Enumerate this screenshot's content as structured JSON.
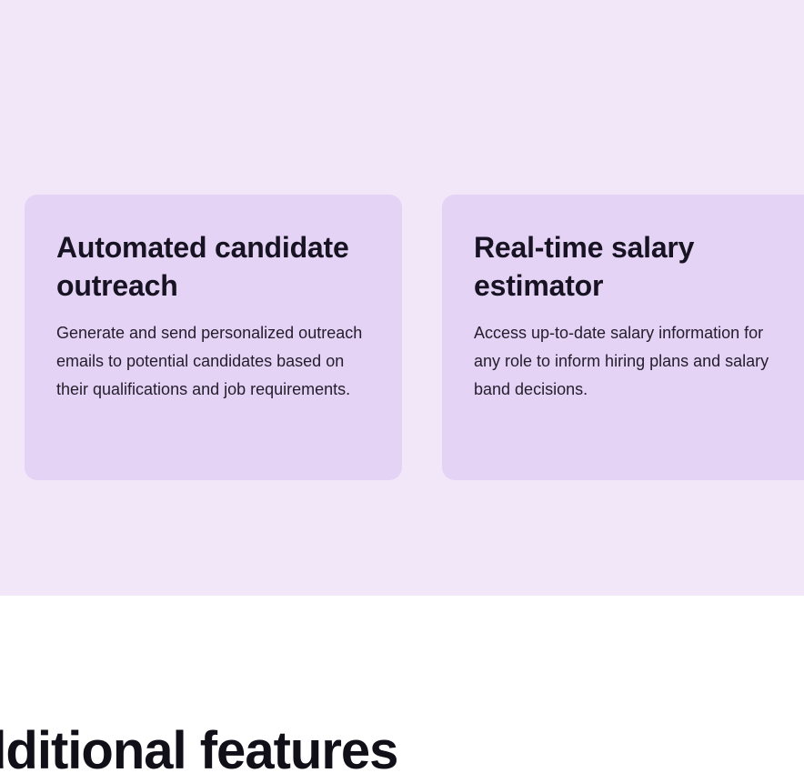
{
  "features": [
    {
      "title": "Automated candidate outreach",
      "description": "Generate and send personalized outreach emails to potential candidates based on their qualifications and job requirements."
    },
    {
      "title": "Real-time salary estimator",
      "description": "Access up-to-date salary information for any role to inform hiring plans and salary band decisions."
    }
  ],
  "additional_section": {
    "heading": "dditional features"
  }
}
